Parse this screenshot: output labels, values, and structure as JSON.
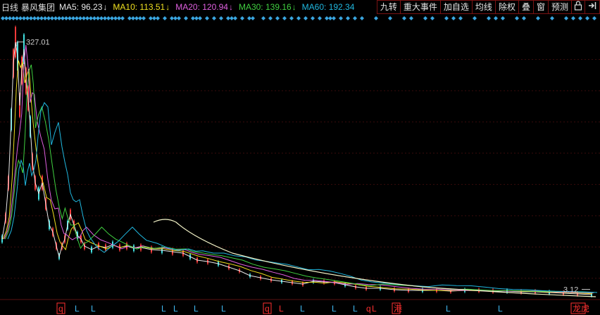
{
  "header": {
    "period": "日线",
    "stock_name": "暴风集团",
    "ma": [
      {
        "label": "MA5: 96.23",
        "color": "#e8e8e8",
        "arrow": "↓"
      },
      {
        "label": "MA10: 113.51",
        "color": "#f0e020",
        "arrow": "↓"
      },
      {
        "label": "MA20: 120.94",
        "color": "#e060e0",
        "arrow": "↓"
      },
      {
        "label": "MA30: 139.16",
        "color": "#40d040",
        "arrow": "↓"
      },
      {
        "label": "MA60: 192.34",
        "color": "#20b8e0",
        "arrow": ""
      }
    ]
  },
  "toolbar": {
    "jiuzhuan": "九转",
    "events": "重大事件",
    "add_fav": "加自选",
    "ma_lines": "均线",
    "exright": "除权",
    "overlay": "叠",
    "window": "窗",
    "predict": "预测",
    "lock_icon": "lock-icon",
    "exit_icon": "exit-icon"
  },
  "chart_data": {
    "type": "line",
    "max_label": "327.01",
    "min_label": "3.12",
    "ylim": [
      0,
      345
    ],
    "series": [
      {
        "name": "MA5",
        "color": "#e8e8e8"
      },
      {
        "name": "MA10",
        "color": "#f0e020"
      },
      {
        "name": "MA20",
        "color": "#e060e0"
      },
      {
        "name": "MA30",
        "color": "#40d040"
      },
      {
        "name": "MA60",
        "color": "#20b8e0"
      },
      {
        "name": "",
        "color": "#f4f4c8"
      }
    ]
  },
  "markers": {
    "bottom": [
      {
        "text": "q",
        "color": "#ff3030",
        "boxed": true
      },
      {
        "text": "L",
        "color": "#40b8f0"
      },
      {
        "text": "L",
        "color": "#40b8f0"
      },
      {
        "text": "L",
        "color": "#40b8f0"
      },
      {
        "text": "L",
        "color": "#40b8f0"
      },
      {
        "text": "L",
        "color": "#40b8f0"
      },
      {
        "text": "L",
        "color": "#40b8f0"
      },
      {
        "text": "q",
        "color": "#ff3030",
        "boxed": true
      },
      {
        "text": "L",
        "color": "#ff3030"
      },
      {
        "text": "L",
        "color": "#40b8f0"
      },
      {
        "text": "L",
        "color": "#40b8f0"
      },
      {
        "text": "L",
        "color": "#40b8f0"
      },
      {
        "text": "q",
        "color": "#ff3030"
      },
      {
        "text": "L",
        "color": "#ff3030"
      },
      {
        "text": "港",
        "color": "#ff3030",
        "boxed": true
      },
      {
        "text": "L",
        "color": "#40b8f0"
      },
      {
        "text": "L",
        "color": "#40b8f0"
      },
      {
        "text": "龙虎",
        "color": "#ff3030",
        "boxed": true
      }
    ]
  }
}
